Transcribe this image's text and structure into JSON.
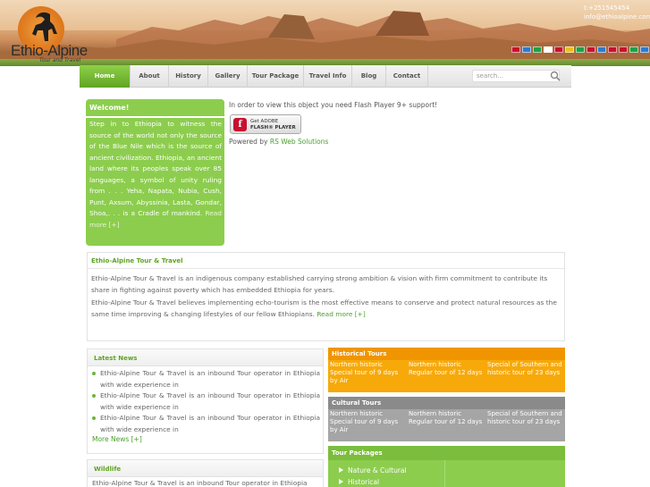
{
  "header": {
    "logo_name": "Ethio-Alpine",
    "logo_tagline": "Tour and Travel",
    "phone": "t:+251545454",
    "email": "info@ethioalpine.com",
    "flag_colors": [
      "#c8102e",
      "#2a7bd4",
      "#1aa34a",
      "#ffffff",
      "#c8102e",
      "#e8c21a",
      "#1aa34a",
      "#c8102e",
      "#2a7bd4",
      "#c8102e",
      "#c8102e",
      "#1aa34a",
      "#2a7bd4"
    ]
  },
  "nav": {
    "items": [
      {
        "label": "Home",
        "active": true
      },
      {
        "label": "About"
      },
      {
        "label": "History"
      },
      {
        "label": "Gallery"
      },
      {
        "label": "Tour Package"
      },
      {
        "label": "Travel Info"
      },
      {
        "label": "Blog"
      },
      {
        "label": "Contact"
      }
    ],
    "search_placeholder": "search..."
  },
  "welcome": {
    "title": "Welcome!",
    "body": "Step in to Ethiopia to witness the source of the world not only the source of the Blue Nile which is the source of ancient civilization. Ethiopia, an ancient land where its peoples speak over 85 languages, a symbol of unity ruling from . . . Yeha, Napata, Nubia, Cush, Punt, Axsum, Abyssinia, Lasta, Gondar, Shoa,. . . is a Cradle of mankind.",
    "read_more": "Read more [+]"
  },
  "flash": {
    "notice": "In order to view this object you need Flash Player 9+ support!",
    "button_line1": "Get ADOBE",
    "button_line2": "FLASH® PLAYER",
    "logo_letter": "f",
    "powered_prefix": "Powered by",
    "powered_link": "RS Web Solutions"
  },
  "about": {
    "title": "Ethio-Alpine Tour & Travel",
    "para1": "Ethio-Alpine Tour & Travel is an indigenous company established carrying strong ambition & vision with firm commitment to contribute its share in fighting against poverty which has embedded Ethiopia for years.",
    "para2": "Ethio-Alpine Tour & Travel believes implementing echo-tourism is the most effective means to conserve and protect natural resources as the same time improving & changing lifestyles of our fellow Ethiopians.",
    "read_more": "Read more [+]"
  },
  "news": {
    "title": "Latest News",
    "items": [
      "Ethio-Alpine Tour & Travel is an inbound Tour operator in Ethiopia with wide experience in",
      "Ethio-Alpine Tour & Travel is an inbound Tour operator in Ethiopia with wide experience in",
      "Ethio-Alpine Tour & Travel is an inbound Tour operator in Ethiopia with wide experience in"
    ],
    "more": "More News [+]"
  },
  "wildlife": {
    "title": "Wildlife",
    "body": "Ethio-Alpine Tour & Travel is an inbound Tour operator in Ethiopia with"
  },
  "historical": {
    "title": "Historical Tours",
    "cells": [
      "Northern historic Special tour of 9 days by Air",
      "Northern historic Regular tour of 12 days",
      "Special of Southern and historic tour of 23 days"
    ]
  },
  "cultural": {
    "title": "Cultural Tours",
    "cells": [
      "Northern historic Special tour of 9 days by Air",
      "Northern historic Regular tour of 12 days",
      "Special of Southern and historic tour of 23 days"
    ]
  },
  "packages": {
    "title": "Tour Packages",
    "items": [
      "Nature & Cultural",
      "Historical"
    ]
  }
}
